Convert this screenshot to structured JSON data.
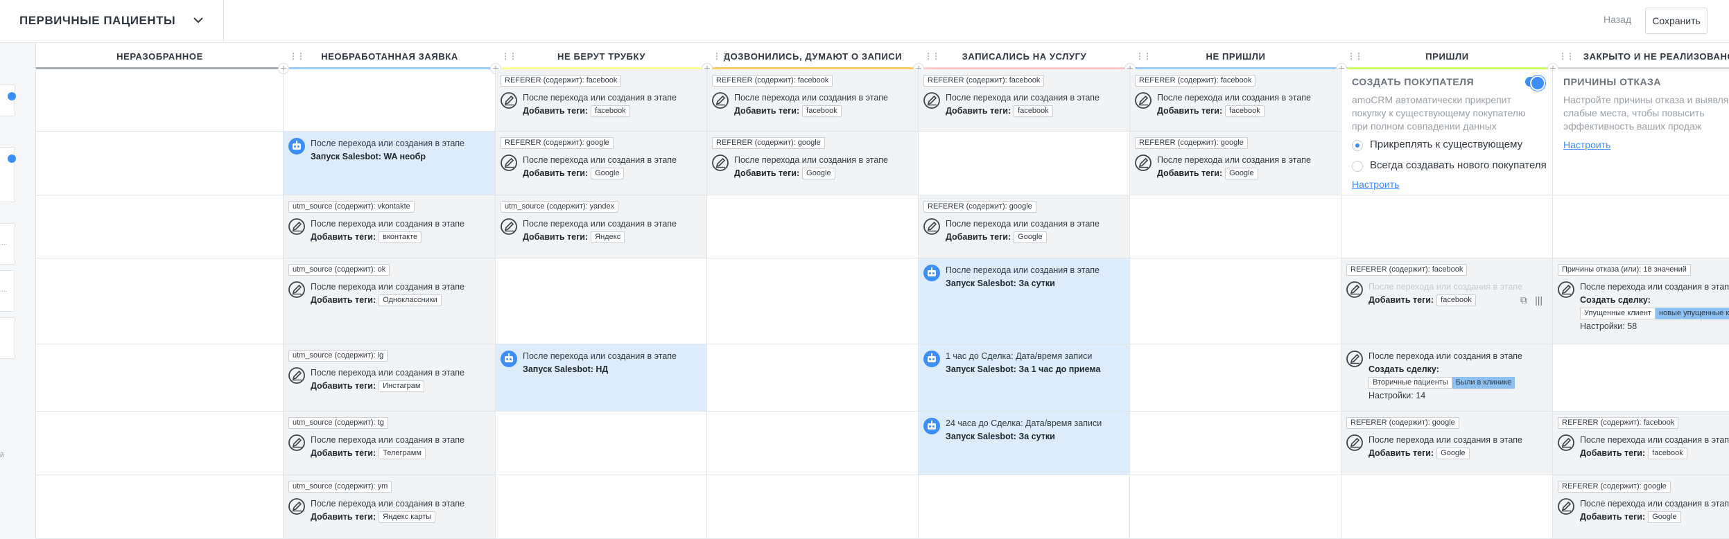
{
  "header": {
    "title": "ПЕРВИЧНЫЕ ПАЦИЕНТЫ",
    "back": "Назад",
    "save": "Сохранить"
  },
  "side": {
    "dots": "...",
    "tick": "й"
  },
  "columns": [
    {
      "label": "НЕРАЗОБРАННОЕ",
      "color": "#a5abb1"
    },
    {
      "label": "НЕОБРАБОТАННАЯ ЗАЯВКА",
      "color": "#99ccff"
    },
    {
      "label": "НЕ БЕРУТ ТРУБКУ",
      "color": "#ffff99"
    },
    {
      "label": "ДОЗВОНИЛИСЬ, ДУМАЮТ О ЗАПИСИ",
      "color": "#ffcc66"
    },
    {
      "label": "ЗАПИСАЛИСЬ НА УСЛУГУ",
      "color": "#ffc8c8"
    },
    {
      "label": "НЕ ПРИШЛИ",
      "color": "#99ccff"
    },
    {
      "label": "ПРИШЛИ",
      "color": "#ccff66"
    },
    {
      "label": "ЗАКРЫТО И НЕ РЕАЛИЗОВАНО",
      "color": "#d5d8db"
    }
  ],
  "common": {
    "trigger": "После перехода или создания в этапе",
    "add_tags": "Добавить теги:",
    "create_deal": "Создать сделку:",
    "salesbot_prefix": "Запуск Salesbot:"
  },
  "cells": {
    "r0c2": {
      "cond": "REFERER (содержит): facebook",
      "tag": "facebook"
    },
    "r0c3": {
      "cond": "REFERER (содержит): facebook",
      "tag": "facebook"
    },
    "r0c4": {
      "cond": "REFERER (содержит): facebook",
      "tag": "facebook"
    },
    "r0c5": {
      "cond": "REFERER (содержит): facebook",
      "tag": "facebook"
    },
    "r1c1": {
      "bot": "Запуск Salesbot: WA необр"
    },
    "r1c2": {
      "cond": "REFERER (содержит): google",
      "tag": "Google"
    },
    "r1c3": {
      "cond": "REFERER (содержит): google",
      "tag": "Google"
    },
    "r1c5": {
      "cond": "REFERER (содержит): google",
      "tag": "Google"
    },
    "r2c1": {
      "cond": "utm_source (содержит): vkontakte",
      "tag": "вконтакте"
    },
    "r2c2": {
      "cond": "utm_source (содержит): yandex",
      "tag": "Яндекс"
    },
    "r2c4": {
      "cond": "REFERER (содержит): google",
      "tag": "Google"
    },
    "r3c1": {
      "cond": "utm_source (содержит): ok",
      "tag": "Одноклассники"
    },
    "r3c4": {
      "bot": "Запуск Salesbot: За сутки"
    },
    "r3c6": {
      "cond": "REFERER (содержит): facebook",
      "tag": "facebook"
    },
    "r3c7": {
      "cond": "Причины отказа (или): 18 значений",
      "pipe": "Упущенные клиент",
      "stage": "новые упущенные клиен",
      "settings": "Настройки: 58"
    },
    "r4c1": {
      "cond": "utm_source (содержит): ig",
      "tag": "Инстаграм"
    },
    "r4c2": {
      "bot": "Запуск Salesbot: НД"
    },
    "r4c4": {
      "trigger": "1 час до Сделка: Дата/время записи",
      "bot": "Запуск Salesbot: За 1 час до приема"
    },
    "r4c6": {
      "pipe": "Вторичные пациенты",
      "stage": "Были в клинике",
      "settings": "Настройки: 14"
    },
    "r5c1": {
      "cond": "utm_source (содержит): tg",
      "tag": "Телеграмм"
    },
    "r5c4": {
      "trigger": "24 часа до Сделка: Дата/время записи",
      "bot": "Запуск Salesbot: За сутки"
    },
    "r5c6": {
      "cond": "REFERER (содержит): google",
      "tag": "Google"
    },
    "r5c7": {
      "cond": "REFERER (содержит): facebook",
      "tag": "facebook"
    },
    "r6c1": {
      "cond": "utm_source (содержит): ym",
      "tag": "Яндекс карты"
    },
    "r6c7": {
      "cond": "REFERER (содержит): google",
      "tag": "Google"
    }
  },
  "widgets": {
    "buyer": {
      "title": "СОЗДАТЬ ПОКУПАТЕЛЯ",
      "desc": "amoCRM автоматически прикрепит покупку к существующему покупателю при полном совпадении данных",
      "opt1": "Прикреплять к существующему",
      "opt2": "Всегда создавать нового покупателя",
      "link": "Настроить"
    },
    "reasons": {
      "title": "ПРИЧИНЫ ОТКАЗА",
      "desc": "Настройте причины отказа и выявляйте слабые места, чтобы повысить эффективность ваших продаж",
      "link": "Настроить"
    }
  },
  "icons": {
    "edit": "pencil-circle-icon",
    "bot": "robot-icon",
    "copy": "copy-icon",
    "grip": "grip-icon",
    "chevron": "chevron-down-icon",
    "add": "plus-icon"
  },
  "colors": {
    "accent": "#3e8ef7",
    "bot_bg": "#dcecfb",
    "gray_bg": "#f2f3f4"
  }
}
